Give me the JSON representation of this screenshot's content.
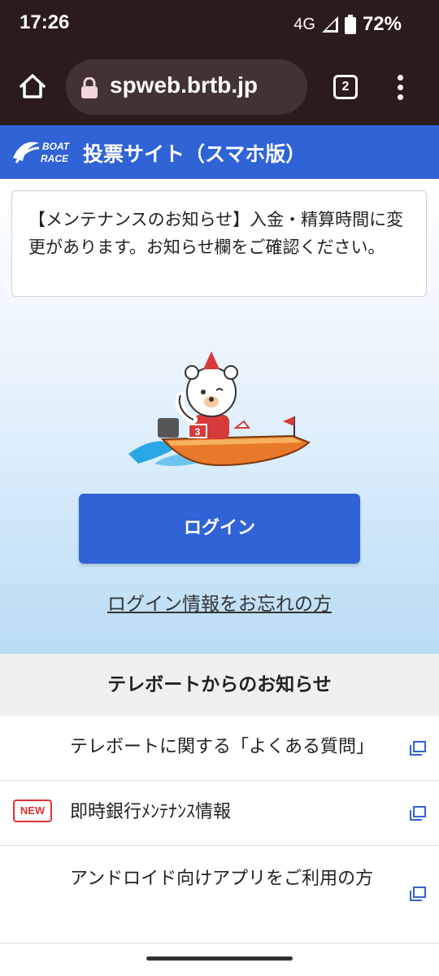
{
  "status_bar": {
    "time": "17:26",
    "network": "4G",
    "battery": "72%"
  },
  "browser": {
    "url": "spweb.brtb.jp",
    "tab_count": "2"
  },
  "header": {
    "logo_line1": "BOAT",
    "logo_line2": "RACE",
    "title": "投票サイト（スマホ版）"
  },
  "notice": {
    "text": "【メンテナンスのお知らせ】入金・精算時間に変更があります。お知らせ欄をご確認ください。"
  },
  "mascot": {
    "boat_number": "3"
  },
  "login": {
    "button_label": "ログイン",
    "forgot_link": "ログイン情報をお忘れの方"
  },
  "news": {
    "heading": "テレボートからのお知らせ",
    "items": [
      {
        "badge": "",
        "text": "テレボートに関する「よくある質問」"
      },
      {
        "badge": "NEW",
        "text": "即時銀行ﾒﾝﾃﾅﾝｽ情報"
      },
      {
        "badge": "",
        "text": "アンドロイド向けアプリをご利用の方"
      }
    ]
  },
  "colors": {
    "brand_blue": "#2f63d6",
    "browser_chrome": "#2b1b1b",
    "new_badge": "#dd3333"
  },
  "icons": [
    "home-icon",
    "lock-icon",
    "tabs-icon",
    "menu-icon",
    "signal-icon",
    "battery-icon",
    "external-link-icon"
  ]
}
